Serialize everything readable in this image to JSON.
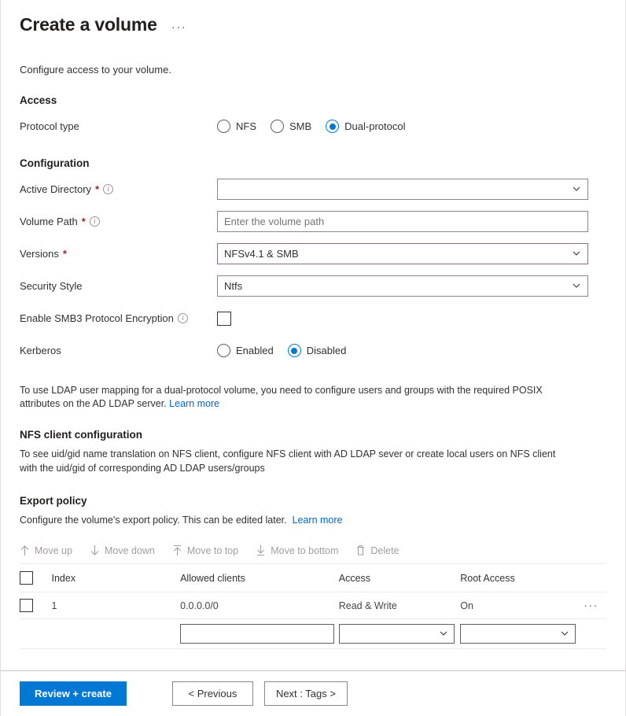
{
  "header": {
    "title": "Create a volume",
    "more_menu": "···"
  },
  "intro": "Configure access to your volume.",
  "access": {
    "section_title": "Access",
    "protocol_label": "Protocol type",
    "options": [
      "NFS",
      "SMB",
      "Dual-protocol"
    ],
    "selected": "Dual-protocol"
  },
  "configuration": {
    "section_title": "Configuration",
    "active_directory": {
      "label": "Active Directory",
      "required": "*",
      "value": ""
    },
    "volume_path": {
      "label": "Volume Path",
      "required": "*",
      "placeholder": "Enter the volume path",
      "value": ""
    },
    "versions": {
      "label": "Versions",
      "required": "*",
      "value": "NFSv4.1 & SMB"
    },
    "security_style": {
      "label": "Security Style",
      "value": "Ntfs"
    },
    "smb3_encryption": {
      "label": "Enable SMB3 Protocol Encryption",
      "checked": false
    },
    "kerberos": {
      "label": "Kerberos",
      "options": [
        "Enabled",
        "Disabled"
      ],
      "selected": "Disabled"
    }
  },
  "ldap_note": {
    "text": "To use LDAP user mapping for a dual-protocol volume, you need to configure users and groups with the required POSIX attributes on the AD LDAP server.",
    "link": "Learn more"
  },
  "nfs_client": {
    "section_title": "NFS client configuration",
    "text": "To see uid/gid name translation on NFS client, configure NFS client with AD LDAP sever or create local users on NFS client with the uid/gid of corresponding AD LDAP users/groups"
  },
  "export_policy": {
    "section_title": "Export policy",
    "description": "Configure the volume's export policy. This can be edited later.",
    "link": "Learn more",
    "toolbar": [
      {
        "label": "Move up",
        "icon": "arrow-up-icon"
      },
      {
        "label": "Move down",
        "icon": "arrow-down-icon"
      },
      {
        "label": "Move to top",
        "icon": "arrow-to-top-icon"
      },
      {
        "label": "Move to bottom",
        "icon": "arrow-to-bottom-icon"
      },
      {
        "label": "Delete",
        "icon": "trash-icon"
      }
    ],
    "columns": [
      "Index",
      "Allowed clients",
      "Access",
      "Root Access"
    ],
    "rows": [
      {
        "index": "1",
        "allowed_clients": "0.0.0.0/0",
        "access": "Read & Write",
        "root_access": "On",
        "more": "···"
      }
    ],
    "new_row": {
      "allowed_clients": "",
      "access": "",
      "root_access": ""
    }
  },
  "footer": {
    "review_create": "Review + create",
    "previous": "< Previous",
    "next": "Next : Tags >"
  },
  "colors": {
    "accent": "#0078d4",
    "link": "#0066cc",
    "required": "#a4262c",
    "highlight_border": "#8d6e85",
    "disabled_text": "#a19f9d"
  }
}
